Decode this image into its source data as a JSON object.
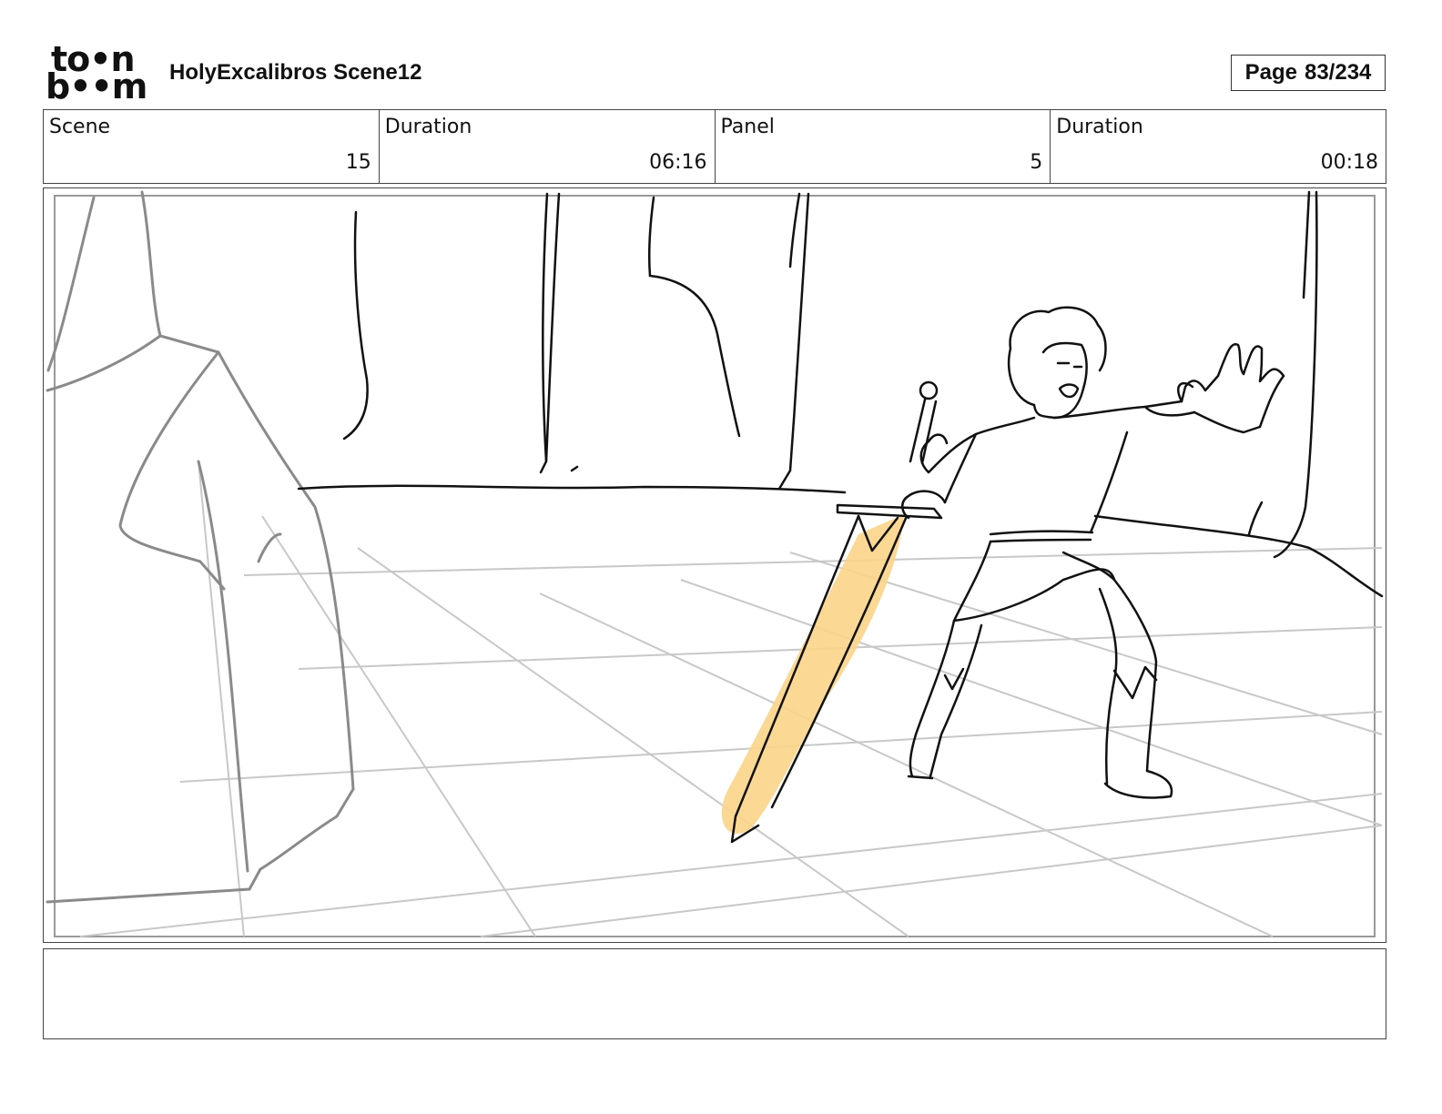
{
  "header": {
    "logo_top": "to•n",
    "logo_bottom": "b••m",
    "title": "HolyExcalibros Scene12",
    "page_label": "Page",
    "page_value": "83/234"
  },
  "info": {
    "scene_label": "Scene",
    "scene_value": "15",
    "scene_duration_label": "Duration",
    "scene_duration_value": "06:16",
    "panel_label": "Panel",
    "panel_value": "5",
    "panel_duration_label": "Duration",
    "panel_duration_value": "00:18"
  },
  "colors": {
    "sword_highlight": "#fbd58a",
    "ink": "#111111",
    "grid": "#c8c8c8",
    "rock": "#8a8a8a"
  },
  "notes": {
    "text": ""
  }
}
